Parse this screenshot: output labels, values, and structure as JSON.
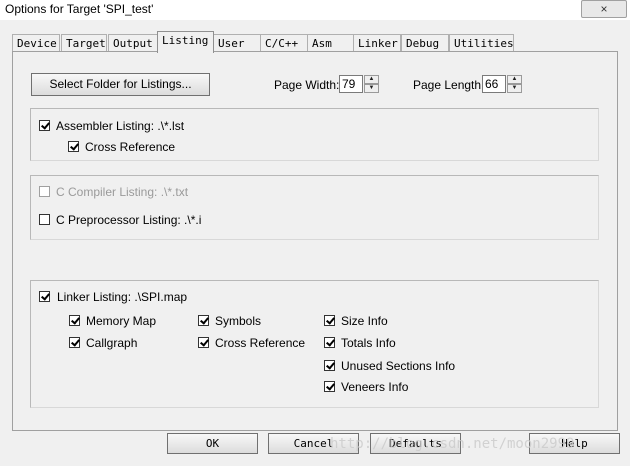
{
  "window": {
    "title": "Options for Target 'SPI_test'",
    "close_glyph": "×"
  },
  "tabs": [
    "Device",
    "Target",
    "Output",
    "Listing",
    "User",
    "C/C++",
    "Asm",
    "Linker",
    "Debug",
    "Utilities"
  ],
  "active_tab": "Listing",
  "listing": {
    "select_folder_label": "Select Folder for Listings...",
    "page_width_label": "Page Width:",
    "page_width_value": "79",
    "page_length_label": "Page Length:",
    "page_length_value": "66"
  },
  "assembler": {
    "listing_label": "Assembler Listing:  .\\*.lst",
    "listing_checked": true,
    "cross_ref_label": "Cross Reference",
    "cross_ref_checked": true
  },
  "compiler": {
    "c_compiler_label": "C Compiler Listing:  .\\*.txt",
    "c_compiler_checked": false,
    "c_compiler_enabled": false,
    "c_preprocessor_label": "C Preprocessor Listing:  .\\*.i",
    "c_preprocessor_checked": false
  },
  "linker": {
    "listing_label": "Linker Listing:  .\\SPI.map",
    "listing_checked": true,
    "options": {
      "memory_map": "Memory Map",
      "callgraph": "Callgraph",
      "symbols": "Symbols",
      "cross_reference": "Cross Reference",
      "size_info": "Size Info",
      "totals_info": "Totals Info",
      "unused_sections_info": "Unused Sections Info",
      "veneers_info": "Veneers Info"
    }
  },
  "buttons": {
    "ok": "OK",
    "cancel": "Cancel",
    "defaults": "Defaults",
    "help": "Help"
  },
  "watermark": "http://blog.csdn.net/moon2999",
  "icons": {
    "spin_up": "▲",
    "spin_down": "▼"
  }
}
